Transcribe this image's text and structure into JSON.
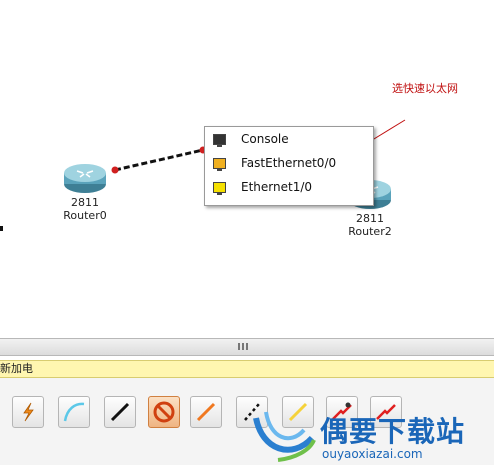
{
  "annotation": "选快速以太网",
  "devices": [
    {
      "model": "2811",
      "name": "Router0"
    },
    {
      "model": "2811",
      "name": "Router2"
    }
  ],
  "port_menu": {
    "items": [
      {
        "label": "Console",
        "icon": "console-port-icon",
        "color": "#333333"
      },
      {
        "label": "FastEthernet0/0",
        "icon": "fastethernet-port-icon",
        "color": "#f0b020"
      },
      {
        "label": "Ethernet1/0",
        "icon": "ethernet-port-icon",
        "color": "#f5e000"
      }
    ]
  },
  "section_label": "新加电",
  "toolbar": {
    "tools": [
      {
        "icon": "automatic-connection-icon"
      },
      {
        "icon": "console-cable-icon"
      },
      {
        "icon": "copper-straight-through-icon"
      },
      {
        "icon": "copper-cross-over-icon",
        "selected": true
      },
      {
        "icon": "fiber-cable-icon"
      },
      {
        "icon": "phone-cable-icon"
      },
      {
        "icon": "coaxial-cable-icon"
      },
      {
        "icon": "serial-dce-icon"
      },
      {
        "icon": "serial-dte-icon"
      }
    ]
  },
  "watermark": {
    "title": "偶要下载站",
    "url": "ouyaoxiazai.com"
  },
  "colors": {
    "accent_red": "#c01010",
    "menu_border": "#9a9a9a",
    "label_bar": "#fff6b0",
    "watermark_blue": "#1a66b8"
  }
}
